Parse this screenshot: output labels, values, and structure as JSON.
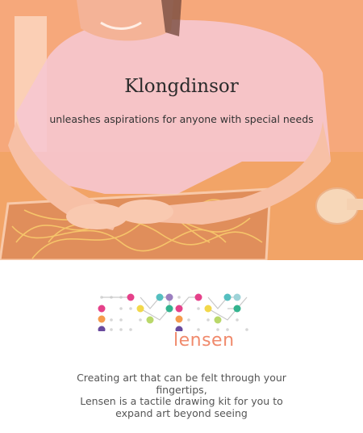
{
  "hero": {
    "title": "Klongdinsor",
    "subtitle": "unleashes aspirations for anyone with special needs"
  },
  "brand": {
    "logo_icon": "dot-grid-logo-icon",
    "name": "lensen",
    "accent_color": "#f08a6c"
  },
  "tagline": {
    "line1": "Creating art that can be felt through your",
    "line2": "fingertips,",
    "line3": "Lensen is a tactile drawing kit for you to",
    "line4": "expand art beyond seeing"
  },
  "colors": {
    "hero_orange": "#f4a97c",
    "logo_pink": "#e5418a",
    "logo_yellow": "#f2d84a",
    "logo_teal": "#55bfc0",
    "logo_green": "#33b38e",
    "logo_orange": "#f59b4c",
    "logo_purple": "#6a4a9e"
  }
}
